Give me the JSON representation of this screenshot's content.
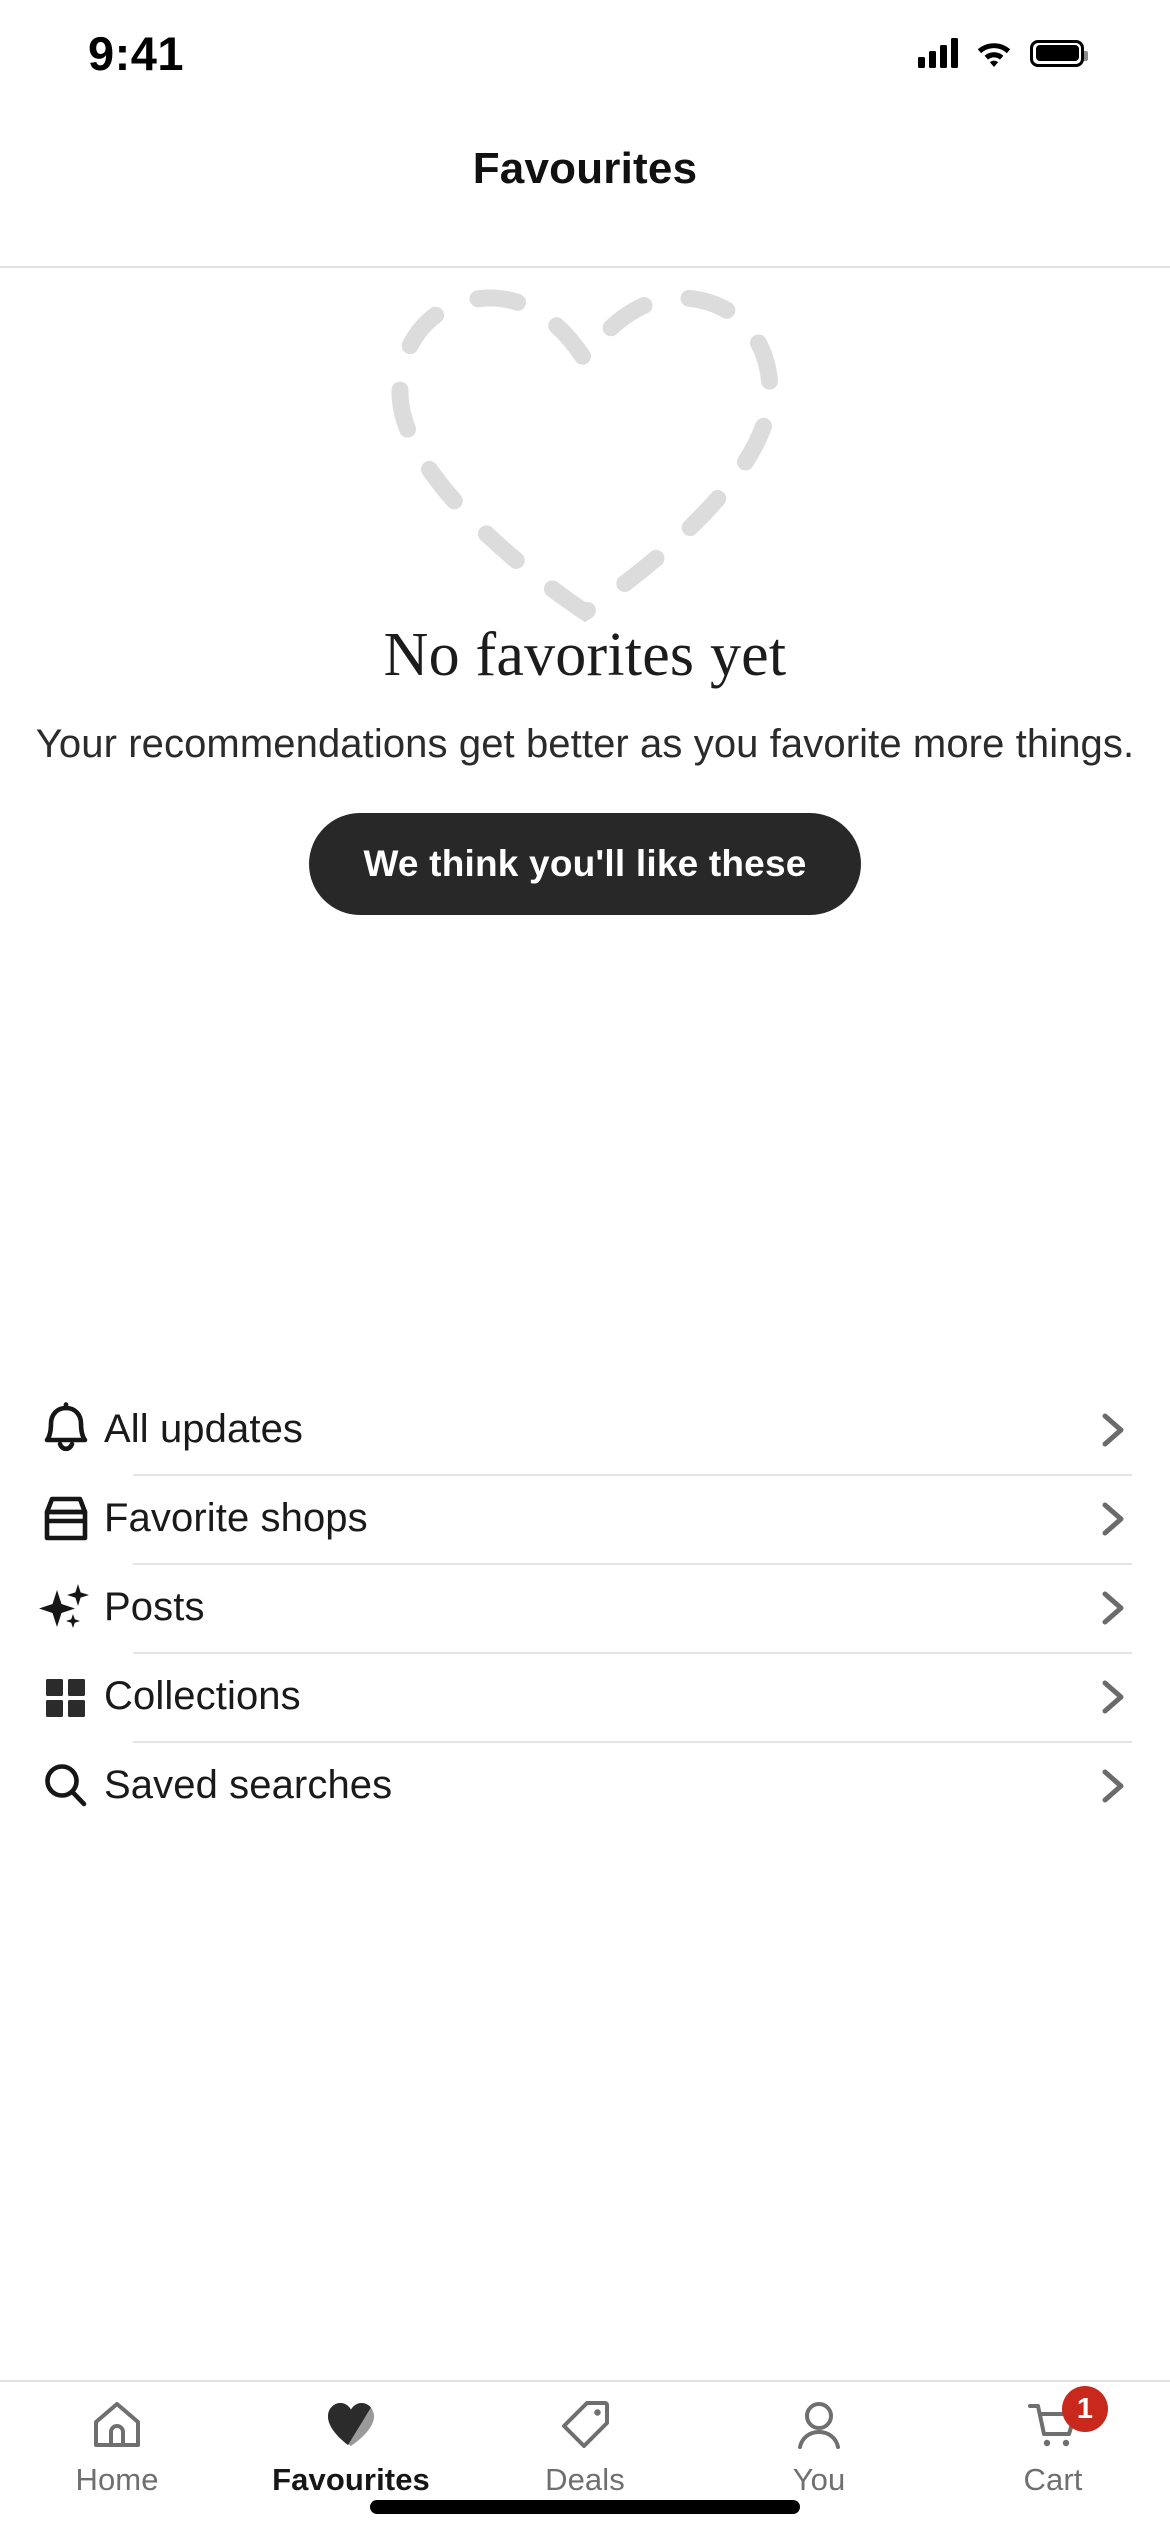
{
  "status_bar": {
    "time": "9:41",
    "icons": [
      "cellular-signal-icon",
      "wifi-icon",
      "battery-icon"
    ]
  },
  "header": {
    "title": "Favourites"
  },
  "empty_state": {
    "illustration": "dashed-heart-outline-icon",
    "title": "No favorites yet",
    "subtitle": "Your recommendations get better as you favorite more things.",
    "cta_label": "We think you'll like these"
  },
  "list": {
    "items": [
      {
        "icon": "bell-icon",
        "label": "All updates",
        "chevron": "chevron-right-icon"
      },
      {
        "icon": "storefront-icon",
        "label": "Favorite shops",
        "chevron": "chevron-right-icon"
      },
      {
        "icon": "sparkles-icon",
        "label": "Posts",
        "chevron": "chevron-right-icon"
      },
      {
        "icon": "grid-icon",
        "label": "Collections",
        "chevron": "chevron-right-icon"
      },
      {
        "icon": "search-icon",
        "label": "Saved searches",
        "chevron": "chevron-right-icon"
      }
    ]
  },
  "tab_bar": {
    "tabs": [
      {
        "icon": "home-icon",
        "label": "Home",
        "active": false,
        "badge": ""
      },
      {
        "icon": "heart-icon",
        "label": "Favourites",
        "active": true,
        "badge": ""
      },
      {
        "icon": "tag-icon",
        "label": "Deals",
        "active": false,
        "badge": ""
      },
      {
        "icon": "person-icon",
        "label": "You",
        "active": false,
        "badge": ""
      },
      {
        "icon": "cart-icon",
        "label": "Cart",
        "active": false,
        "badge": "1"
      }
    ]
  },
  "colors": {
    "accent_dark": "#282828",
    "badge_red": "#c8291c",
    "divider": "#e4e4e4",
    "muted_text": "#6f6f6f",
    "illustration_gray": "#dcdcdc"
  }
}
